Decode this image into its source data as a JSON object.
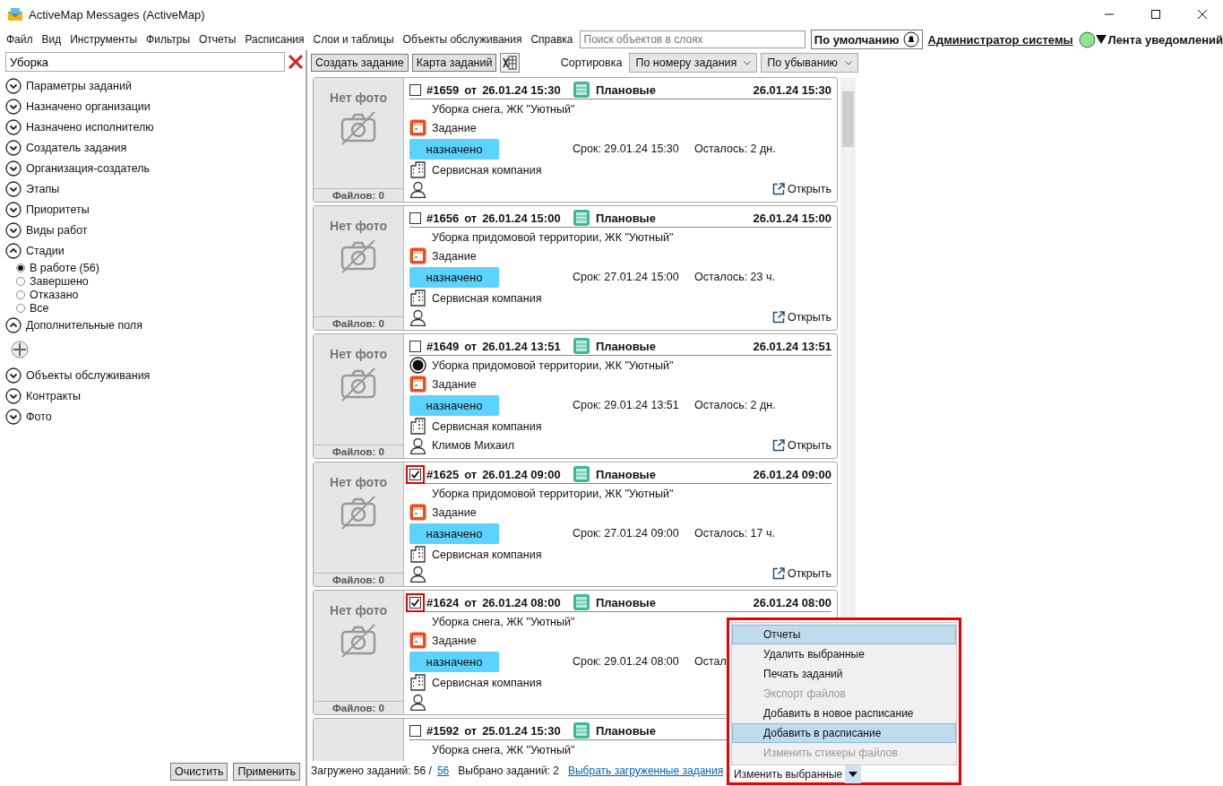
{
  "window": {
    "title": "ActiveMap Messages (ActiveMap)"
  },
  "menu": [
    "Файл",
    "Вид",
    "Инструменты",
    "Фильтры",
    "Отчеты",
    "Расписания",
    "Слои и таблицы",
    "Объекты обслуживания",
    "Справка"
  ],
  "layer_search": {
    "placeholder": "Поиск объектов в слоях"
  },
  "default_button": "По умолчанию",
  "user_link": "Администратор системы",
  "notifications": "Лента уведомлений",
  "filter": {
    "search": {
      "value": "Уборка"
    },
    "sections": [
      {
        "label": "Параметры заданий",
        "expanded": false
      },
      {
        "label": "Назначено организации",
        "expanded": false
      },
      {
        "label": "Назначено исполнителю",
        "expanded": false
      },
      {
        "label": "Создатель задания",
        "expanded": false
      },
      {
        "label": "Организация-создатель",
        "expanded": false
      },
      {
        "label": "Этапы",
        "expanded": false
      },
      {
        "label": "Приоритеты",
        "expanded": false
      },
      {
        "label": "Виды работ",
        "expanded": false
      },
      {
        "label": "Стадии",
        "expanded": true,
        "kind": "radio",
        "options": [
          {
            "label": "В работе (56)",
            "selected": true
          },
          {
            "label": "Завершено",
            "selected": false
          },
          {
            "label": "Отказано",
            "selected": false
          },
          {
            "label": "Все",
            "selected": false
          }
        ]
      },
      {
        "label": "Дополнительные поля",
        "expanded": true,
        "kind": "add"
      },
      {
        "label": "Объекты обслуживания",
        "expanded": false
      },
      {
        "label": "Контракты",
        "expanded": false
      },
      {
        "label": "Фото",
        "expanded": false
      }
    ],
    "buttons": [
      "Очистить",
      "Применить"
    ]
  },
  "toolbar": {
    "buttons": [
      "Создать задание",
      "Карта заданий"
    ],
    "sort_label": "Сортировка",
    "sort_field": "По номеру задания",
    "sort_order": "По убыванию"
  },
  "tasks": [
    {
      "checked": false,
      "number": "#1659",
      "from_label": "от",
      "created": "26.01.24 15:30",
      "category": "Плановые",
      "date": "26.01.24 15:30",
      "flagged": false,
      "title": "Уборка снега, ЖК \"Уютный\"",
      "type": "Задание",
      "status": "назначено",
      "due": "Срок: 29.01.24 15:30",
      "remaining": "Осталось: 2 дн.",
      "organization": "Сервисная компания",
      "open": "Открыть",
      "photo_label": "Нет фото",
      "files": "Файлов: 0"
    },
    {
      "checked": false,
      "number": "#1656",
      "from_label": "от",
      "created": "26.01.24 15:00",
      "category": "Плановые",
      "date": "26.01.24 15:00",
      "flagged": false,
      "title": "Уборка придомовой территории, ЖК \"Уютный\"",
      "type": "Задание",
      "status": "назначено",
      "due": "Срок: 27.01.24 15:00",
      "remaining": "Осталось: 23 ч.",
      "organization": "Сервисная компания",
      "open": "Открыть",
      "photo_label": "Нет фото",
      "files": "Файлов: 0"
    },
    {
      "checked": false,
      "number": "#1649",
      "from_label": "от",
      "created": "26.01.24 13:51",
      "category": "Плановые",
      "date": "26.01.24 13:51",
      "flagged": true,
      "title": "Уборка придомовой территории, ЖК \"Уютный\"",
      "type": "Задание",
      "status": "назначено",
      "due": "Срок: 29.01.24 13:51",
      "remaining": "Осталось: 2 дн.",
      "organization": "Сервисная компания",
      "assignee": "Климов Михаил",
      "open": "Открыть",
      "photo_label": "Нет фото",
      "files": "Файлов: 0"
    },
    {
      "checked": true,
      "number": "#1625",
      "from_label": "от",
      "created": "26.01.24 09:00",
      "category": "Плановые",
      "date": "26.01.24 09:00",
      "flagged": false,
      "title": "Уборка придомовой территории, ЖК \"Уютный\"",
      "type": "Задание",
      "status": "назначено",
      "due": "Срок: 27.01.24 09:00",
      "remaining": "Осталось: 17 ч.",
      "organization": "Сервисная компания",
      "open": "Открыть",
      "photo_label": "Нет фото",
      "files": "Файлов: 0"
    },
    {
      "checked": true,
      "number": "#1624",
      "from_label": "от",
      "created": "26.01.24 08:00",
      "category": "Плановые",
      "date": "26.01.24 08:00",
      "flagged": false,
      "title": "Уборка снега, ЖК \"Уютный\"",
      "type": "Задание",
      "status": "назначено",
      "due": "Срок: 29.01.24 08:00",
      "remaining": "Остал",
      "organization": "Сервисная компания",
      "photo_label": "Нет фото",
      "files": "Файлов: 0"
    },
    {
      "checked": false,
      "number": "#1592",
      "from_label": "от",
      "created": "25.01.24 15:30",
      "category": "Плановые",
      "flagged": false,
      "title": "Уборка снега, ЖК \"Уютный\""
    }
  ],
  "status_bar": {
    "loaded_label": "Загружено заданий: 56 /",
    "loaded_link": "56",
    "selected": "Выбрано заданий: 2",
    "select_link": "Выбрать загруженные задания"
  },
  "bulk_menu": {
    "items": [
      {
        "label": "Отчеты",
        "highlighted": true,
        "disabled": false
      },
      {
        "label": "Удалить выбранные",
        "highlighted": false,
        "disabled": false
      },
      {
        "label": "Печать заданий",
        "highlighted": false,
        "disabled": false
      },
      {
        "label": "Экспорт файлов",
        "highlighted": false,
        "disabled": true
      },
      {
        "label": "Добавить в новое расписание",
        "highlighted": false,
        "disabled": false
      },
      {
        "label": "Добавить в расписание",
        "highlighted": true,
        "disabled": false
      },
      {
        "label": "Изменить стикеры файлов",
        "highlighted": false,
        "disabled": true
      }
    ],
    "button": "Изменить выбранные"
  }
}
